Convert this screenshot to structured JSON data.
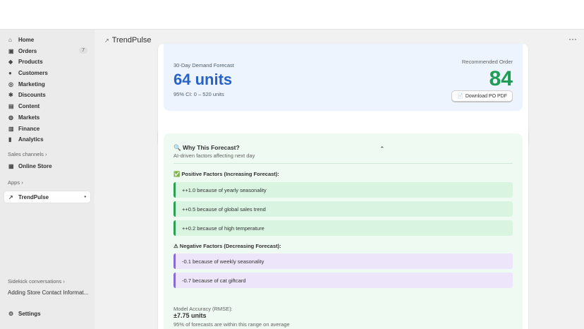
{
  "sidebar": {
    "items": [
      {
        "label": "Home",
        "icon": "home-icon",
        "glyph": "⌂"
      },
      {
        "label": "Orders",
        "icon": "inbox-icon",
        "glyph": "▣",
        "badge": "7"
      },
      {
        "label": "Products",
        "icon": "tag-icon",
        "glyph": "◆"
      },
      {
        "label": "Customers",
        "icon": "person-icon",
        "glyph": "●"
      },
      {
        "label": "Marketing",
        "icon": "target-icon",
        "glyph": "◎"
      },
      {
        "label": "Discounts",
        "icon": "discount-icon",
        "glyph": "✱"
      },
      {
        "label": "Content",
        "icon": "content-icon",
        "glyph": "▤"
      },
      {
        "label": "Markets",
        "icon": "globe-icon",
        "glyph": "◍"
      },
      {
        "label": "Finance",
        "icon": "bank-icon",
        "glyph": "▥"
      },
      {
        "label": "Analytics",
        "icon": "bar-chart-icon",
        "glyph": "▮"
      }
    ],
    "sales_channels_label": "Sales channels",
    "online_store_label": "Online Store",
    "apps_label": "Apps",
    "trendpulse_label": "TrendPulse",
    "sidekick_label": "Sidekick conversations",
    "sidekick_item": "Adding Store Contact Informat...",
    "settings_label": "Settings"
  },
  "header": {
    "app_title": "TrendPulse",
    "more_glyph": "···"
  },
  "forecast": {
    "label": "30-Day Demand Forecast",
    "value": "64 units",
    "ci": "95% CI: 0 – 520 units",
    "recommended_label": "Recommended Order",
    "recommended_value": "84",
    "pdf_button": "Download PO PDF"
  },
  "why": {
    "title": "🔍 Why This Forecast?",
    "subtitle": "AI-driven factors affecting next day",
    "positive_title": "✅ Positive Factors (Increasing Forecast):",
    "positive": [
      "++1.0 because of yearly seasonality",
      "++0.5 because of global sales trend",
      "++0.2 because of high temperature"
    ],
    "negative_title": "⚠ Negative Factors (Decreasing Forecast):",
    "negative": [
      "-0.1 because of weekly seasonality",
      "-0.7 because of cat giftcard"
    ],
    "accuracy_label": "Model Accuracy (RMSE):",
    "accuracy_value": "±7.75 units",
    "accuracy_note": "95% of forecasts are within this range on average"
  },
  "colors": {
    "forecast_value": "#2563c9",
    "recommended_value": "#1f9d55",
    "positive_accent": "#2e9e55",
    "negative_accent": "#8a6bd6"
  }
}
